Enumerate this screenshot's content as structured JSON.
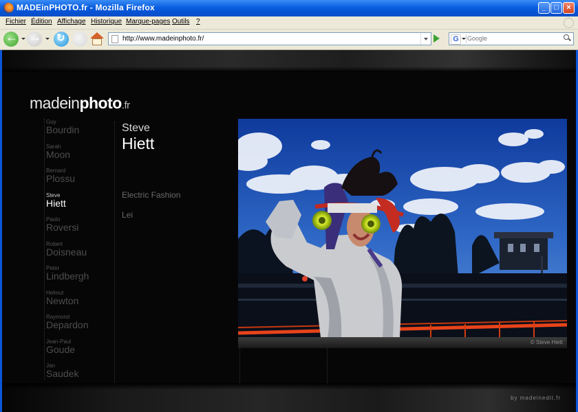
{
  "window": {
    "title": "MADEinPHOTO.fr - Mozilla Firefox"
  },
  "menu": [
    "Fichier",
    "Édition",
    "Affichage",
    "Historique",
    "Marque-pages",
    "Outils",
    "?"
  ],
  "toolbar": {
    "url": "http://www.madeinphoto.fr/",
    "search_placeholder": "Google"
  },
  "site": {
    "logo": {
      "part1": "made",
      "part2": "in",
      "part3": "photo",
      "suffix": ".fr"
    },
    "credit": "by madeinedit.fr",
    "photographers": [
      {
        "first": "Guy",
        "last": "Bourdin",
        "active": false
      },
      {
        "first": "Sarah",
        "last": "Moon",
        "active": false
      },
      {
        "first": "Bernard",
        "last": "Plossu",
        "active": false
      },
      {
        "first": "Steve",
        "last": "Hiett",
        "active": true
      },
      {
        "first": "Paolo",
        "last": "Roversi",
        "active": false
      },
      {
        "first": "Robert",
        "last": "Doisneau",
        "active": false
      },
      {
        "first": "Peter",
        "last": "Lindbergh",
        "active": false
      },
      {
        "first": "Helmut",
        "last": "Newton",
        "active": false
      },
      {
        "first": "Raymond",
        "last": "Depardon",
        "active": false
      },
      {
        "first": "Jean-Paul",
        "last": "Goude",
        "active": false
      },
      {
        "first": "Jan",
        "last": "Saudek",
        "active": false
      }
    ],
    "selected": {
      "first": "Steve",
      "last": "Hiett"
    },
    "series": [
      "Electric Fashion",
      "Lei"
    ],
    "photo_credit": "© Steve Hiett"
  }
}
